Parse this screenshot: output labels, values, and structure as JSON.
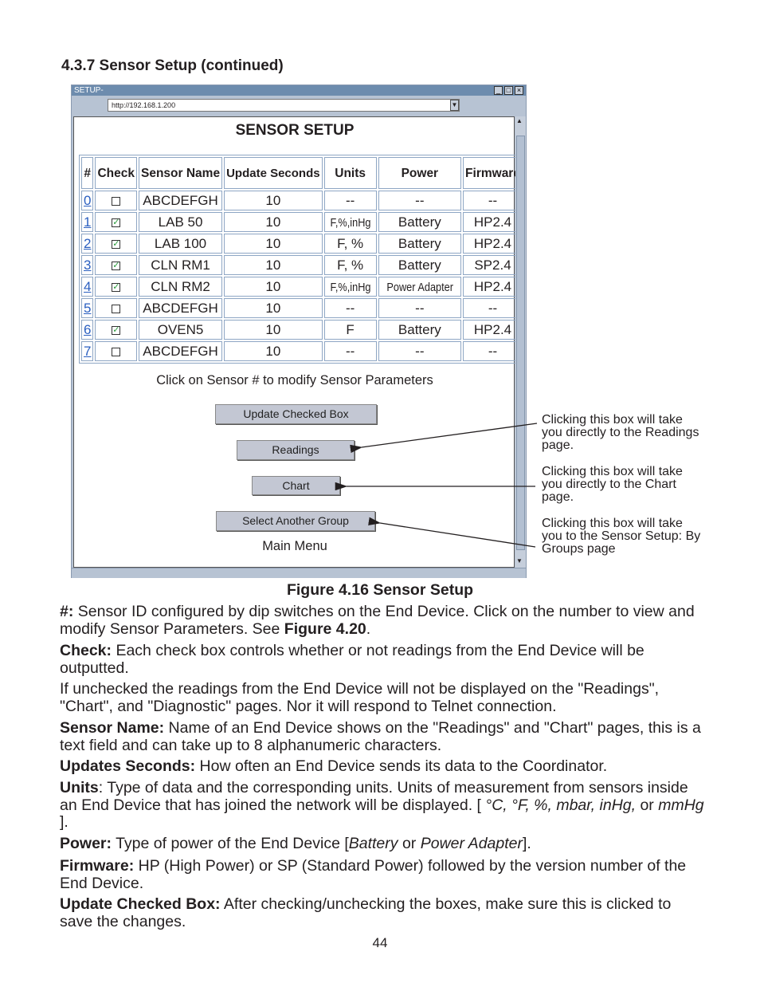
{
  "heading": "4.3.7  Sensor Setup (continued)",
  "window": {
    "title": "SETUP-",
    "address": "http://192.168.1.200",
    "buttons": [
      "_",
      "□",
      "×"
    ]
  },
  "page": {
    "title": "SENSOR SETUP",
    "columns": [
      "#",
      "Check",
      "Sensor Name",
      "Update Seconds",
      "Units",
      "Power",
      "Firmware"
    ],
    "rows": [
      {
        "id": "0",
        "checked": false,
        "name": "ABCDEFGH",
        "update": "10",
        "units": "--",
        "power": "--",
        "firmware": "--"
      },
      {
        "id": "1",
        "checked": true,
        "name": "LAB 50",
        "update": "10",
        "units": "F,%,inHg",
        "power": "Battery",
        "firmware": "HP2.4"
      },
      {
        "id": "2",
        "checked": true,
        "name": "LAB 100",
        "update": "10",
        "units": "F, %",
        "power": "Battery",
        "firmware": "HP2.4"
      },
      {
        "id": "3",
        "checked": true,
        "name": "CLN RM1",
        "update": "10",
        "units": "F, %",
        "power": "Battery",
        "firmware": "SP2.4"
      },
      {
        "id": "4",
        "checked": true,
        "name": "CLN RM2",
        "update": "10",
        "units": "F,%,inHg",
        "power": "Power Adapter",
        "firmware": "HP2.4"
      },
      {
        "id": "5",
        "checked": false,
        "name": "ABCDEFGH",
        "update": "10",
        "units": "--",
        "power": "--",
        "firmware": "--"
      },
      {
        "id": "6",
        "checked": true,
        "name": "OVEN5",
        "update": "10",
        "units": "F",
        "power": "Battery",
        "firmware": "HP2.4"
      },
      {
        "id": "7",
        "checked": false,
        "name": "ABCDEFGH",
        "update": "10",
        "units": "--",
        "power": "--",
        "firmware": "--"
      }
    ],
    "hint": "Click on Sensor # to modify Sensor Parameters",
    "update_btn": "Update Checked Box",
    "readings_btn": "Readings",
    "chart_btn": "Chart",
    "group_btn": "Select Another Group",
    "main_menu": "Main Menu"
  },
  "notes": [
    "Clicking this box will take you directly to the Readings page.",
    "Clicking this box will take you directly to the Chart page.",
    "Clicking this box will take you to the Sensor Setup: By Groups page"
  ],
  "caption": "Figure 4.16  Sensor Setup",
  "paras": [
    {
      "b": "#:",
      "t": "  Sensor ID configured by dip switches on the End Device. Click on the number to view and modify Sensor Parameters. See ",
      "b2": "Figure 4.20",
      "t2": "."
    },
    {
      "b": "Check:",
      "t": "  Each check box controls whether or not readings from the End Device will be outputted."
    },
    {
      "b": "",
      "t": "If unchecked the readings from the End Device will not be displayed on the \"Readings\", \"Chart\", and \"Diagnostic\" pages. Nor it will respond to Telnet connection."
    },
    {
      "b": "Sensor Name:",
      "t": "  Name of an End Device shows on the \"Readings\" and \"Chart\" pages, this is a text field and can take up to 8 alphanumeric characters."
    },
    {
      "b": "Updates Seconds:",
      "t": "  How often an End Device sends its data to the Coordinator."
    },
    {
      "b": "Units",
      "t": ":  Type of data and the corresponding units. Units of measurement from sensors inside an End Device that has joined the network will be displayed. [ ",
      "i": "°C, °F, %, mbar, inHg,",
      "t2": " or ",
      "i2": "mmHg",
      "t3": " ]."
    },
    {
      "b": "Power:",
      "t": "  Type of power of the End Device [",
      "i": "Battery",
      "t2": " or ",
      "i2": "Power Adapter",
      "t3": "]."
    },
    {
      "b": "Firmware:",
      "t": "  HP (High Power) or SP (Standard Power) followed by the version number of the End Device."
    },
    {
      "b": "Update Checked Box:",
      "t": "  After checking/unchecking the boxes, make sure this is clicked to save the changes."
    }
  ],
  "page_number": "44"
}
